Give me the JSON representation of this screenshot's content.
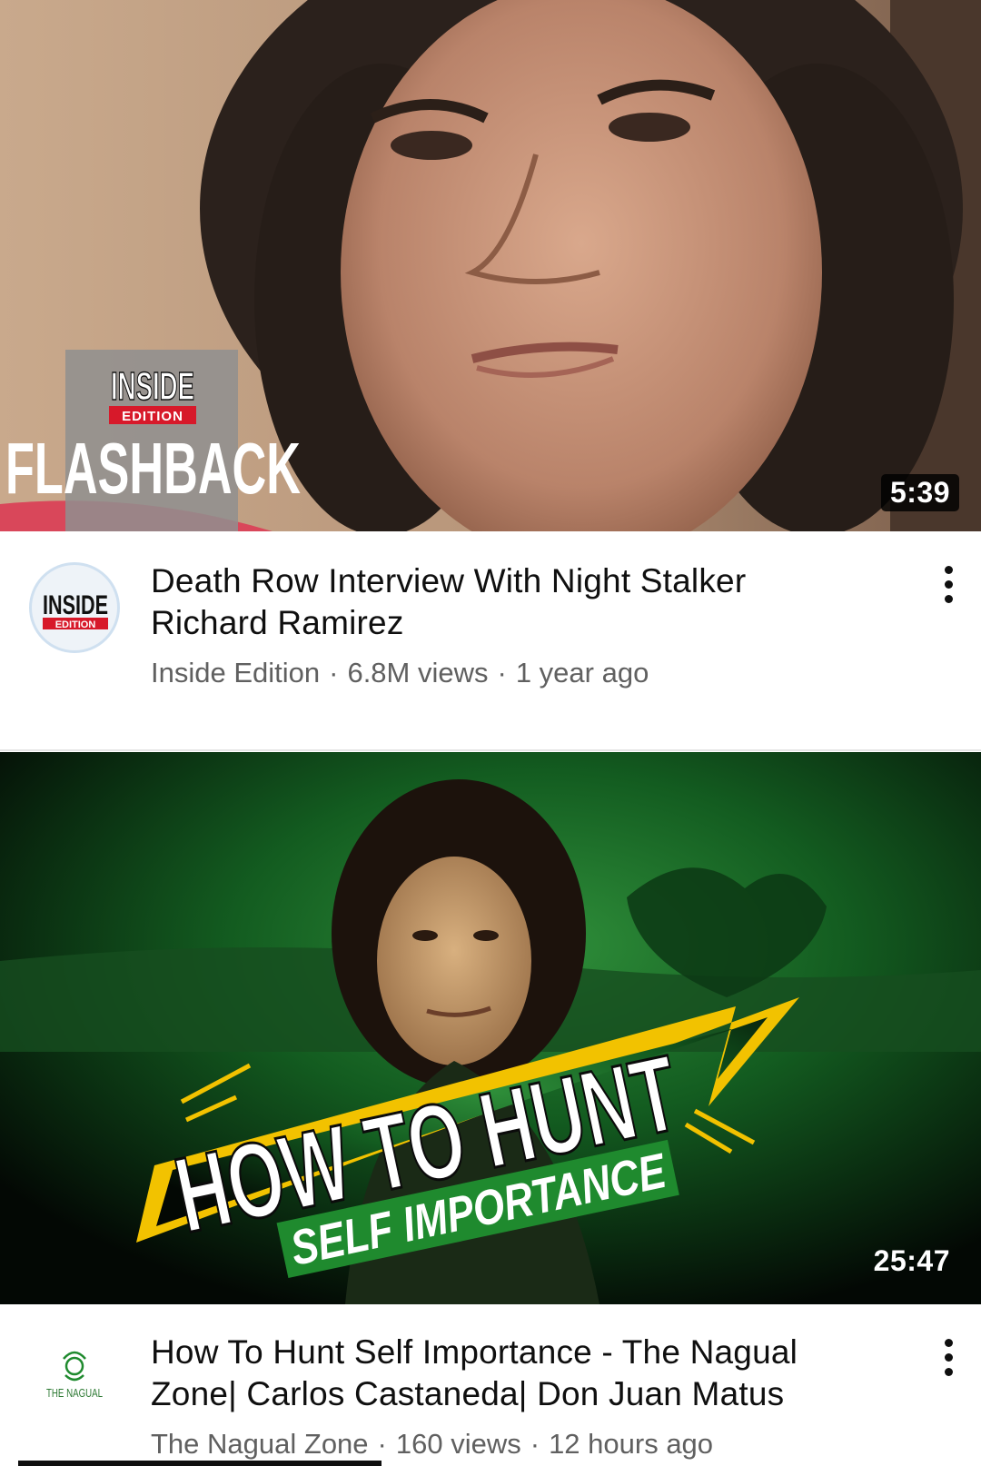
{
  "videos": [
    {
      "thumbnail_overlay": {
        "brand_top": "INSIDE",
        "brand_sub": "EDITION",
        "headline": "FLASHBACK"
      },
      "duration": "5:39",
      "channel_avatar": {
        "brand_top": "INSIDE",
        "brand_sub": "EDITION"
      },
      "title_line1": "Death Row Interview With Night Stalker",
      "title_line2": "Richard Ramirez",
      "channel": "Inside Edition",
      "views": "6.8M views",
      "age": "1 year ago",
      "menu_icon": "more-vert-icon"
    },
    {
      "thumbnail_overlay": {
        "headline": "HOW TO HUNT",
        "subheadline": "SELF IMPORTANCE"
      },
      "duration": "25:47",
      "channel_avatar": {
        "brand": "THE NAGUAL"
      },
      "title_line1": "How To Hunt Self Importance - The Nagual",
      "title_line2": "Zone| Carlos Castaneda| Don Juan Matus",
      "channel": "The Nagual Zone",
      "views": "160 views",
      "age": "12 hours ago",
      "menu_icon": "more-vert-icon"
    }
  ],
  "separator": "·",
  "colors": {
    "inside_edition_red": "#d7192a",
    "nagual_green": "#1f8a2e",
    "accent_yellow": "#f2c200",
    "meta_gray": "#606060"
  }
}
